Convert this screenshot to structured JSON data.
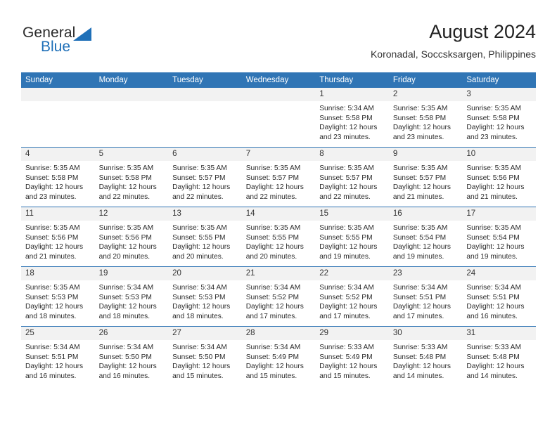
{
  "brand": {
    "name_top": "General",
    "name_bottom": "Blue",
    "accent_color": "#1f70b8"
  },
  "header": {
    "title": "August 2024",
    "subtitle": "Koronadal, Soccsksargen, Philippines"
  },
  "theme": {
    "header_blue": "#3075b5",
    "daynum_band": "#f2f2f2"
  },
  "calendar": {
    "weekday_headers": [
      "Sunday",
      "Monday",
      "Tuesday",
      "Wednesday",
      "Thursday",
      "Friday",
      "Saturday"
    ],
    "weeks": [
      [
        {
          "day": "",
          "blank": true
        },
        {
          "day": "",
          "blank": true
        },
        {
          "day": "",
          "blank": true
        },
        {
          "day": "",
          "blank": true
        },
        {
          "day": "1",
          "sunrise": "Sunrise: 5:34 AM",
          "sunset": "Sunset: 5:58 PM",
          "daylight": "Daylight: 12 hours and 23 minutes."
        },
        {
          "day": "2",
          "sunrise": "Sunrise: 5:35 AM",
          "sunset": "Sunset: 5:58 PM",
          "daylight": "Daylight: 12 hours and 23 minutes."
        },
        {
          "day": "3",
          "sunrise": "Sunrise: 5:35 AM",
          "sunset": "Sunset: 5:58 PM",
          "daylight": "Daylight: 12 hours and 23 minutes."
        }
      ],
      [
        {
          "day": "4",
          "sunrise": "Sunrise: 5:35 AM",
          "sunset": "Sunset: 5:58 PM",
          "daylight": "Daylight: 12 hours and 23 minutes."
        },
        {
          "day": "5",
          "sunrise": "Sunrise: 5:35 AM",
          "sunset": "Sunset: 5:58 PM",
          "daylight": "Daylight: 12 hours and 22 minutes."
        },
        {
          "day": "6",
          "sunrise": "Sunrise: 5:35 AM",
          "sunset": "Sunset: 5:57 PM",
          "daylight": "Daylight: 12 hours and 22 minutes."
        },
        {
          "day": "7",
          "sunrise": "Sunrise: 5:35 AM",
          "sunset": "Sunset: 5:57 PM",
          "daylight": "Daylight: 12 hours and 22 minutes."
        },
        {
          "day": "8",
          "sunrise": "Sunrise: 5:35 AM",
          "sunset": "Sunset: 5:57 PM",
          "daylight": "Daylight: 12 hours and 22 minutes."
        },
        {
          "day": "9",
          "sunrise": "Sunrise: 5:35 AM",
          "sunset": "Sunset: 5:57 PM",
          "daylight": "Daylight: 12 hours and 21 minutes."
        },
        {
          "day": "10",
          "sunrise": "Sunrise: 5:35 AM",
          "sunset": "Sunset: 5:56 PM",
          "daylight": "Daylight: 12 hours and 21 minutes."
        }
      ],
      [
        {
          "day": "11",
          "sunrise": "Sunrise: 5:35 AM",
          "sunset": "Sunset: 5:56 PM",
          "daylight": "Daylight: 12 hours and 21 minutes."
        },
        {
          "day": "12",
          "sunrise": "Sunrise: 5:35 AM",
          "sunset": "Sunset: 5:56 PM",
          "daylight": "Daylight: 12 hours and 20 minutes."
        },
        {
          "day": "13",
          "sunrise": "Sunrise: 5:35 AM",
          "sunset": "Sunset: 5:55 PM",
          "daylight": "Daylight: 12 hours and 20 minutes."
        },
        {
          "day": "14",
          "sunrise": "Sunrise: 5:35 AM",
          "sunset": "Sunset: 5:55 PM",
          "daylight": "Daylight: 12 hours and 20 minutes."
        },
        {
          "day": "15",
          "sunrise": "Sunrise: 5:35 AM",
          "sunset": "Sunset: 5:55 PM",
          "daylight": "Daylight: 12 hours and 19 minutes."
        },
        {
          "day": "16",
          "sunrise": "Sunrise: 5:35 AM",
          "sunset": "Sunset: 5:54 PM",
          "daylight": "Daylight: 12 hours and 19 minutes."
        },
        {
          "day": "17",
          "sunrise": "Sunrise: 5:35 AM",
          "sunset": "Sunset: 5:54 PM",
          "daylight": "Daylight: 12 hours and 19 minutes."
        }
      ],
      [
        {
          "day": "18",
          "sunrise": "Sunrise: 5:35 AM",
          "sunset": "Sunset: 5:53 PM",
          "daylight": "Daylight: 12 hours and 18 minutes."
        },
        {
          "day": "19",
          "sunrise": "Sunrise: 5:34 AM",
          "sunset": "Sunset: 5:53 PM",
          "daylight": "Daylight: 12 hours and 18 minutes."
        },
        {
          "day": "20",
          "sunrise": "Sunrise: 5:34 AM",
          "sunset": "Sunset: 5:53 PM",
          "daylight": "Daylight: 12 hours and 18 minutes."
        },
        {
          "day": "21",
          "sunrise": "Sunrise: 5:34 AM",
          "sunset": "Sunset: 5:52 PM",
          "daylight": "Daylight: 12 hours and 17 minutes."
        },
        {
          "day": "22",
          "sunrise": "Sunrise: 5:34 AM",
          "sunset": "Sunset: 5:52 PM",
          "daylight": "Daylight: 12 hours and 17 minutes."
        },
        {
          "day": "23",
          "sunrise": "Sunrise: 5:34 AM",
          "sunset": "Sunset: 5:51 PM",
          "daylight": "Daylight: 12 hours and 17 minutes."
        },
        {
          "day": "24",
          "sunrise": "Sunrise: 5:34 AM",
          "sunset": "Sunset: 5:51 PM",
          "daylight": "Daylight: 12 hours and 16 minutes."
        }
      ],
      [
        {
          "day": "25",
          "sunrise": "Sunrise: 5:34 AM",
          "sunset": "Sunset: 5:51 PM",
          "daylight": "Daylight: 12 hours and 16 minutes."
        },
        {
          "day": "26",
          "sunrise": "Sunrise: 5:34 AM",
          "sunset": "Sunset: 5:50 PM",
          "daylight": "Daylight: 12 hours and 16 minutes."
        },
        {
          "day": "27",
          "sunrise": "Sunrise: 5:34 AM",
          "sunset": "Sunset: 5:50 PM",
          "daylight": "Daylight: 12 hours and 15 minutes."
        },
        {
          "day": "28",
          "sunrise": "Sunrise: 5:34 AM",
          "sunset": "Sunset: 5:49 PM",
          "daylight": "Daylight: 12 hours and 15 minutes."
        },
        {
          "day": "29",
          "sunrise": "Sunrise: 5:33 AM",
          "sunset": "Sunset: 5:49 PM",
          "daylight": "Daylight: 12 hours and 15 minutes."
        },
        {
          "day": "30",
          "sunrise": "Sunrise: 5:33 AM",
          "sunset": "Sunset: 5:48 PM",
          "daylight": "Daylight: 12 hours and 14 minutes."
        },
        {
          "day": "31",
          "sunrise": "Sunrise: 5:33 AM",
          "sunset": "Sunset: 5:48 PM",
          "daylight": "Daylight: 12 hours and 14 minutes."
        }
      ]
    ]
  }
}
